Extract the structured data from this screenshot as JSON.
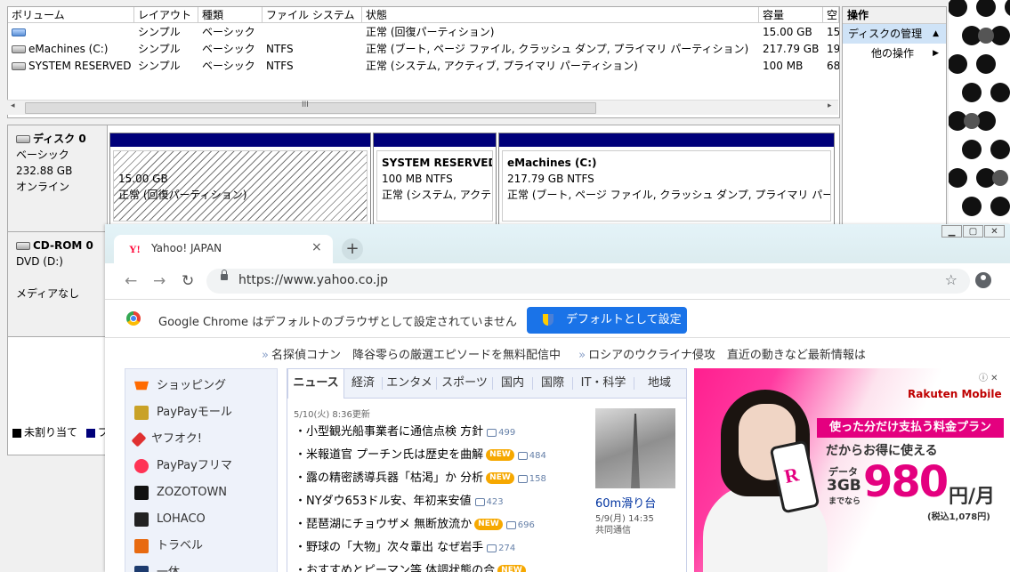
{
  "volume_table": {
    "columns": [
      "ボリューム",
      "レイアウト",
      "種類",
      "ファイル システム",
      "状態",
      "容量",
      "空"
    ],
    "rows": [
      {
        "name": "",
        "layout": "シンプル",
        "type": "ベーシック",
        "fs": "",
        "status": "正常 (回復パーティション)",
        "capacity": "15.00 GB",
        "free": "15"
      },
      {
        "name": "eMachines (C:)",
        "layout": "シンプル",
        "type": "ベーシック",
        "fs": "NTFS",
        "status": "正常 (ブート, ページ ファイル, クラッシュ ダンプ, プライマリ パーティション)",
        "capacity": "217.79 GB",
        "free": "19"
      },
      {
        "name": "SYSTEM RESERVED",
        "layout": "シンプル",
        "type": "ベーシック",
        "fs": "NTFS",
        "status": "正常 (システム, アクティブ, プライマリ パーティション)",
        "capacity": "100 MB",
        "free": "68"
      }
    ],
    "scroll_mark": "III"
  },
  "disks": [
    {
      "name": "ディスク 0",
      "type": "ベーシック",
      "size": "232.88 GB",
      "state": "オンライン"
    },
    {
      "name": "CD-ROM 0",
      "type": "DVD (D:)",
      "state": "メディアなし"
    }
  ],
  "partitions": [
    {
      "title": "",
      "size": "15.00 GB",
      "status": "正常 (回復パーティション)"
    },
    {
      "title": "SYSTEM RESERVED",
      "size": "100 MB NTFS",
      "status": "正常 (システム, アクテ"
    },
    {
      "title": "eMachines  (C:)",
      "size": "217.79 GB NTFS",
      "status": "正常 (ブート, ページ ファイル, クラッシュ ダンプ, プライマリ パー"
    }
  ],
  "legend": {
    "unallocated": "未割り当て",
    "primary": "プ"
  },
  "actions": {
    "title": "操作",
    "selected": "ディスクの管理",
    "sub": "他の操作"
  },
  "chrome": {
    "tab_favicon": "Y!",
    "tab_title": "Yahoo! JAPAN",
    "tab_close": "×",
    "new_tab": "+",
    "url": "https://www.yahoo.co.jp",
    "infobar_message": "Google Chrome はデフォルトのブラウザとして設定されていません",
    "infobar_button": "デフォルトとして設定"
  },
  "yahoo": {
    "ticker": [
      "名探偵コナン　降谷零らの厳選エピソードを無料配信中",
      "ロシアのウクライナ侵攻　直近の動きなど最新情報は"
    ],
    "services": [
      "ショッピング",
      "PayPayモール",
      "ヤフオク!",
      "PayPayフリマ",
      "ZOZOTOWN",
      "LOHACO",
      "トラベル",
      "一休"
    ],
    "news_tabs": [
      "ニュース",
      "経済",
      "エンタメ",
      "スポーツ",
      "国内",
      "国際",
      "IT・科学",
      "地域"
    ],
    "updated": "5/10(火) 8:36更新",
    "headlines": [
      {
        "title": "小型観光船事業者に通信点検 方針",
        "new": "",
        "comments": "499"
      },
      {
        "title": "米報道官 プーチン氏は歴史を曲解",
        "new": "NEW",
        "comments": "484"
      },
      {
        "title": "露の精密誘導兵器「枯渇」か 分析",
        "new": "NEW",
        "comments": "158"
      },
      {
        "title": "NYダウ653ドル安、年初来安値",
        "new": "",
        "comments": "423"
      },
      {
        "title": "琵琶湖にチョウザメ 無断放流か",
        "new": "NEW",
        "comments": "696"
      },
      {
        "title": "野球の「大物」次々輩出 なぜ岩手",
        "new": "",
        "comments": "274"
      },
      {
        "title": "おすすめとピーマン等 体調状態の合",
        "new": "NEW",
        "comments": ""
      }
    ],
    "photo_caption": "60m滑り台",
    "photo_date": "5/9(月) 14:35",
    "photo_source": "共同通信",
    "ad": {
      "brand": "Rakuten Mobile",
      "headline": "使った分だけ支払う料金プラン",
      "subhead": "だからお得に使える",
      "data_label": "データ",
      "data_amount": "3GB",
      "data_suffix": "までなら",
      "price": "980",
      "unit": "円/月",
      "tax": "(税込1,078円)",
      "phone_mark": "R"
    }
  }
}
